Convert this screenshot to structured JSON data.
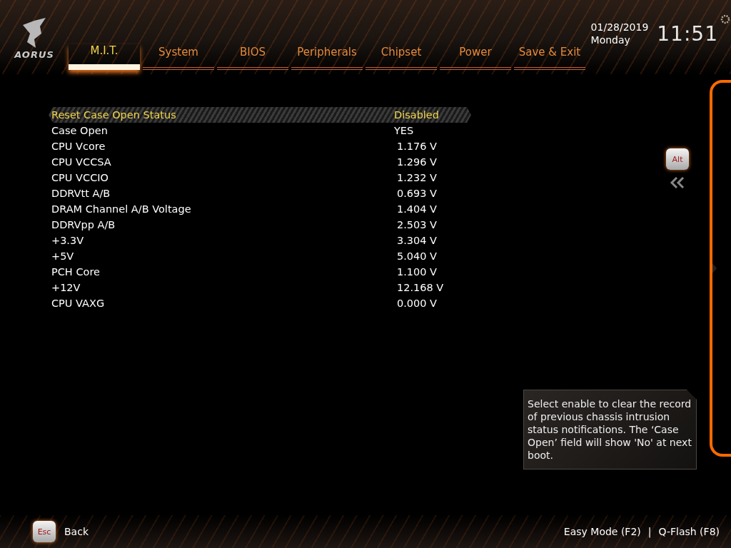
{
  "header": {
    "logo": "AORUS",
    "tabs": [
      {
        "label": "M.I.T.",
        "selected": true
      },
      {
        "label": "System",
        "selected": false
      },
      {
        "label": "BIOS",
        "selected": false
      },
      {
        "label": "Peripherals",
        "selected": false
      },
      {
        "label": "Chipset",
        "selected": false
      },
      {
        "label": "Power",
        "selected": false
      },
      {
        "label": "Save & Exit",
        "selected": false
      }
    ],
    "date": "01/28/2019",
    "weekday": "Monday",
    "time": "11:51"
  },
  "settings": [
    {
      "label": "Reset Case Open Status",
      "value": "Disabled",
      "kind": "option",
      "selected": true
    },
    {
      "label": "Case Open",
      "value": "YES",
      "kind": "option",
      "selected": false
    },
    {
      "label": "CPU Vcore",
      "value": "1.176 V",
      "kind": "reading",
      "selected": false
    },
    {
      "label": "CPU VCCSA",
      "value": "1.296 V",
      "kind": "reading",
      "selected": false
    },
    {
      "label": "CPU VCCIO",
      "value": "1.232 V",
      "kind": "reading",
      "selected": false
    },
    {
      "label": "DDRVtt A/B",
      "value": "0.693 V",
      "kind": "reading",
      "selected": false
    },
    {
      "label": "DRAM Channel A/B Voltage",
      "value": "1.404 V",
      "kind": "reading",
      "selected": false
    },
    {
      "label": "DDRVpp A/B",
      "value": "2.503 V",
      "kind": "reading",
      "selected": false
    },
    {
      "label": "+3.3V",
      "value": "3.304 V",
      "kind": "reading",
      "selected": false
    },
    {
      "label": "+5V",
      "value": "5.040 V",
      "kind": "reading",
      "selected": false
    },
    {
      "label": "PCH Core",
      "value": "1.100 V",
      "kind": "reading",
      "selected": false
    },
    {
      "label": "+12V",
      "value": "12.168 V",
      "kind": "reading",
      "selected": false
    },
    {
      "label": "CPU VAXG",
      "value": "0.000 V",
      "kind": "reading",
      "selected": false
    }
  ],
  "side": {
    "alt_key": "Alt"
  },
  "help": "Select enable to clear the record of previous chassis intrusion status notifications. The ‘Case Open’ field will show 'No' at next boot.",
  "footer": {
    "esc_key": "Esc",
    "back": "Back",
    "easy_mode": "Easy Mode (F2)",
    "separator": "|",
    "qflash": "Q-Flash (F8)"
  }
}
